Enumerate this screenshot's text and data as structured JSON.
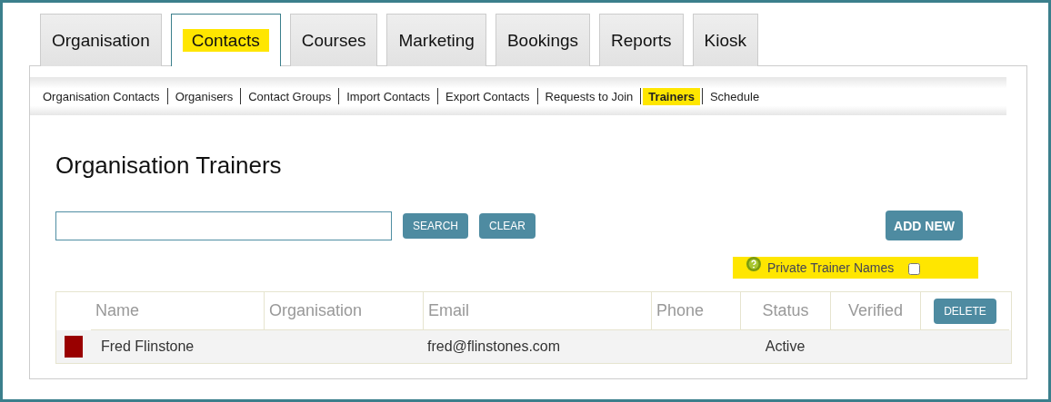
{
  "tabs": [
    {
      "label": "Organisation",
      "selected": false,
      "highlighted": false
    },
    {
      "label": "Contacts",
      "selected": true,
      "highlighted": true
    },
    {
      "label": "Courses",
      "selected": false,
      "highlighted": false
    },
    {
      "label": "Marketing",
      "selected": false,
      "highlighted": false
    },
    {
      "label": "Bookings",
      "selected": false,
      "highlighted": false
    },
    {
      "label": "Reports",
      "selected": false,
      "highlighted": false
    },
    {
      "label": "Kiosk",
      "selected": false,
      "highlighted": false
    }
  ],
  "subnav": [
    {
      "label": "Organisation Contacts",
      "selected": false
    },
    {
      "label": "Organisers",
      "selected": false
    },
    {
      "label": "Contact Groups",
      "selected": false
    },
    {
      "label": "Import Contacts",
      "selected": false
    },
    {
      "label": "Export Contacts",
      "selected": false
    },
    {
      "label": "Requests to Join",
      "selected": false
    },
    {
      "label": "Trainers",
      "selected": true
    },
    {
      "label": "Schedule",
      "selected": false
    }
  ],
  "title": "Organisation Trainers",
  "search": {
    "search_button": "SEARCH",
    "clear_button": "CLEAR"
  },
  "add_button": "ADD NEW",
  "private_option": {
    "label": "Private Trainer Names",
    "checked": false,
    "highlighted": true
  },
  "table": {
    "columns": [
      "Name",
      "Organisation",
      "Email",
      "Phone",
      "Status",
      "Verified"
    ],
    "delete_button": "DELETE",
    "rows": [
      {
        "color": "#990000",
        "cells": [
          "Fred Flinstone",
          "",
          "fred@flinstones.com",
          "",
          "Active",
          ""
        ]
      }
    ]
  }
}
